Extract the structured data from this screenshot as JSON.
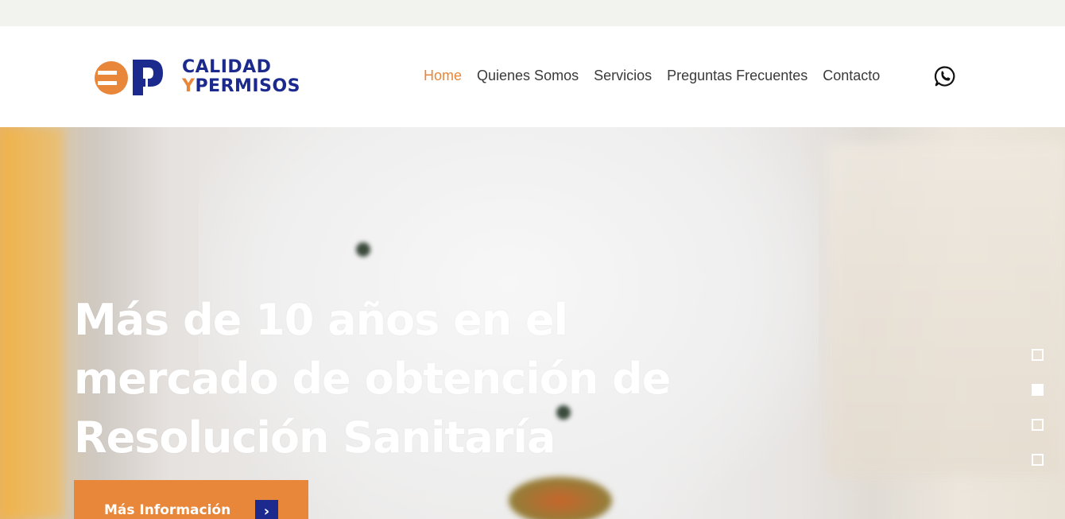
{
  "brand": {
    "line1": "CALIDAD",
    "line2_y": "Y",
    "line2_rest": "PERMISOS",
    "logo_icon": "cp-logo-mark",
    "colors": {
      "orange": "#e8863a",
      "navy": "#1b2a8c"
    }
  },
  "nav": {
    "items": [
      {
        "label": "Home",
        "active": true
      },
      {
        "label": "Quienes Somos",
        "active": false
      },
      {
        "label": "Servicios",
        "active": false
      },
      {
        "label": "Preguntas Frecuentes",
        "active": false
      },
      {
        "label": "Contacto",
        "active": false
      }
    ],
    "whatsapp_icon": "whatsapp-icon"
  },
  "hero": {
    "title": "Más de 10 años en el mercado de obtención de Resolución Sanitaría",
    "cta_label": "Más Información",
    "cta_icon": "chevron-right-icon",
    "slides": {
      "count": 4,
      "active_index": 1
    }
  }
}
